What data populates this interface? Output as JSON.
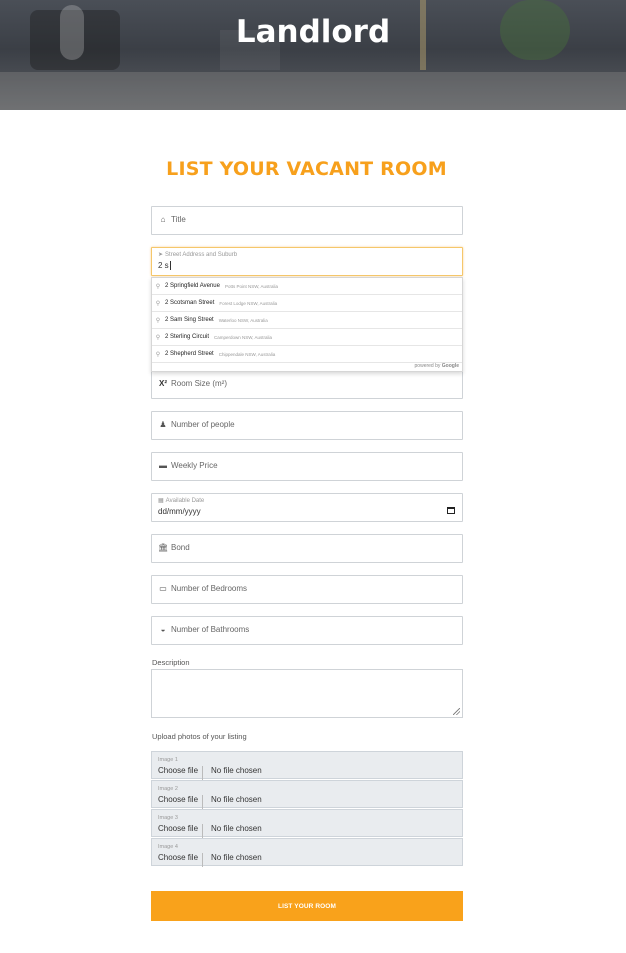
{
  "hero": {
    "title": "Landlord"
  },
  "form": {
    "heading": "LIST YOUR VACANT ROOM",
    "fields": {
      "title": {
        "placeholder": "Title",
        "icon": "home-icon"
      },
      "address": {
        "label": "Street Address and Suburb",
        "value": "2 s",
        "icon": "location-arrow-icon"
      },
      "room_size": {
        "placeholder": "Room Size (m²)",
        "icon": "superscript-icon"
      },
      "people": {
        "placeholder": "Number of people",
        "icon": "person-icon"
      },
      "price": {
        "placeholder": "Weekly Price",
        "icon": "credit-card-icon"
      },
      "date": {
        "label": "Available Date",
        "value": "dd/mm/yyyy",
        "icon": "calendar-icon"
      },
      "bond": {
        "placeholder": "Bond",
        "icon": "bank-icon"
      },
      "bedrooms": {
        "placeholder": "Number of Bedrooms",
        "icon": "bed-icon"
      },
      "bathrooms": {
        "placeholder": "Number of Bathrooms",
        "icon": "bath-icon"
      }
    },
    "description_label": "Description",
    "upload_label": "Upload photos of your listing",
    "images": [
      {
        "caption": "Image 1",
        "button": "Choose file",
        "status": "No file chosen"
      },
      {
        "caption": "Image 2",
        "button": "Choose file",
        "status": "No file chosen"
      },
      {
        "caption": "Image 3",
        "button": "Choose file",
        "status": "No file chosen"
      },
      {
        "caption": "Image 4",
        "button": "Choose file",
        "status": "No file chosen"
      }
    ],
    "submit_label": "LIST YOUR ROOM"
  },
  "autocomplete": {
    "suggestions": [
      {
        "main": "2 Springfield Avenue",
        "sub": "Potts Point NSW, Australia"
      },
      {
        "main": "2 Scotsman Street",
        "sub": "Forest Lodge NSW, Australia"
      },
      {
        "main": "2 Sam Sing Street",
        "sub": "Waterloo NSW, Australia"
      },
      {
        "main": "2 Sterling Circuit",
        "sub": "Camperdown NSW, Australia"
      },
      {
        "main": "2 Shepherd Street",
        "sub": "Chippendale NSW, Australia"
      }
    ],
    "footer_prefix": "powered by",
    "footer_brand": "Google"
  },
  "colors": {
    "accent": "#f9a21b",
    "heading": "#f7a01c",
    "field_border": "#cfd3d7"
  }
}
